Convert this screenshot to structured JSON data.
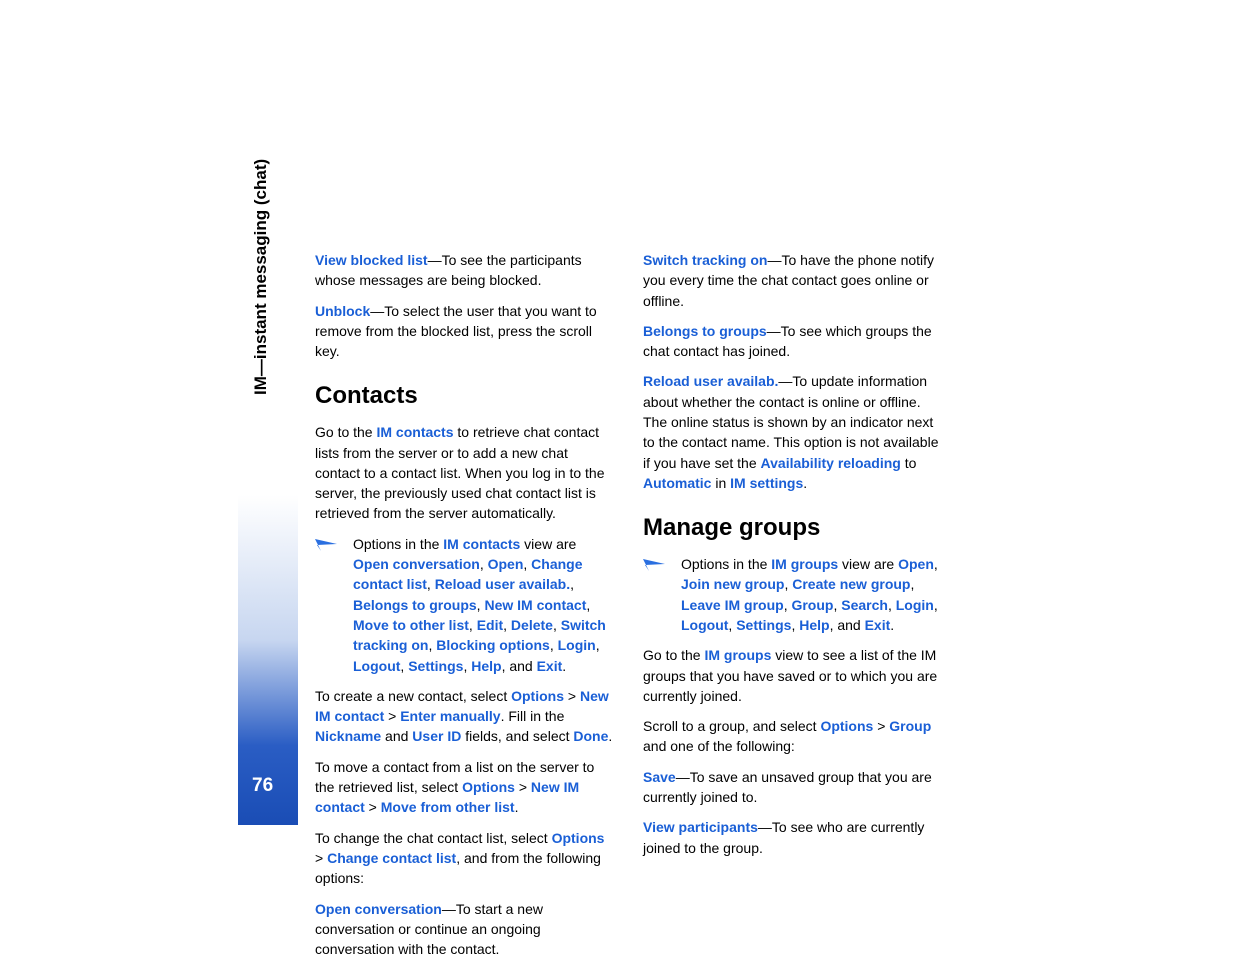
{
  "sidebar": {
    "label": "IM—instant messaging (chat)",
    "page": "76"
  },
  "left": {
    "p1_kw": "View blocked list",
    "p1_txt": "—To see the participants whose messages are being blocked.",
    "p2_kw": "Unblock",
    "p2_txt": "—To select the user that you want to remove from the blocked list, press the scroll key.",
    "h1": "Contacts",
    "p3a": "Go to the ",
    "p3_kw": "IM contacts",
    "p3b": " to retrieve chat contact lists from the server or to add a new chat contact to a contact list. When you log in to the server, the previously used chat contact list is retrieved from the server automatically.",
    "tip1": {
      "a": "Options in the ",
      "kw1": "IM contacts",
      "b": " view are ",
      "kw2": "Open conversation",
      "c": ", ",
      "kw3": "Open",
      "kw4": "Change contact list",
      "kw5": "Reload user availab.",
      "kw6": "Belongs to groups",
      "kw7": "New IM contact",
      "kw8": "Move to other list",
      "kw9": "Edit",
      "kw10": "Delete",
      "kw11": "Switch tracking on",
      "kw12": "Blocking options",
      "kw13": "Login",
      "kw14": "Logout",
      "kw15": "Settings",
      "kw16": "Help",
      "d": ", and ",
      "kw17": "Exit",
      "e": "."
    },
    "p4a": "To create a new contact, select ",
    "p4_kw1": "Options",
    "p4b": " > ",
    "p4_kw2": "New IM contact",
    "p4_kw3": "Enter manually",
    "p4c": ". Fill in the ",
    "p4_kw4": "Nickname",
    "p4d": " and ",
    "p4_kw5": "User ID",
    "p4e": " fields, and select ",
    "p4_kw6": "Done",
    "p4f": ".",
    "p5a": "To move a contact from a list on the server to the retrieved list, select ",
    "p5_kw1": "Options",
    "p5_kw2": "New IM contact",
    "p5_kw3": "Move from other list",
    "p5b": ".",
    "p6a": "To change the chat contact list, select ",
    "p6_kw1": "Options",
    "p6_kw2": "Change contact list",
    "p6b": ", and from the following options:",
    "p7_kw": "Open conversation",
    "p7_txt": "—To start a new conversation or continue an ongoing conversation with the contact."
  },
  "right": {
    "p1_kw": "Switch tracking on",
    "p1_txt": "—To have the phone notify you every time the chat contact goes online or offline.",
    "p2_kw": "Belongs to groups",
    "p2_txt": "—To see which groups the chat contact has joined.",
    "p3_kw": "Reload user availab.",
    "p3a": "—To update information about whether the contact is online or offline. The online status is shown by an indicator next to the contact name. This option is not available if you have set the ",
    "p3_kw2": "Availability reloading",
    "p3b": " to ",
    "p3_kw3": "Automatic",
    "p3c": " in ",
    "p3_kw4": "IM settings",
    "p3d": ".",
    "h1": "Manage groups",
    "tip1": {
      "a": "Options in the ",
      "kw1": "IM groups",
      "b": " view are ",
      "kw2": "Open",
      "kw3": "Join new group",
      "kw4": "Create new group",
      "kw5": "Leave IM group",
      "kw6": "Group",
      "kw7": "Search",
      "kw8": "Login",
      "kw9": "Logout",
      "kw10": "Settings",
      "kw11": "Help",
      "c": ", and ",
      "kw12": "Exit",
      "d": "."
    },
    "p4a": "Go to the ",
    "p4_kw": "IM groups",
    "p4b": " view to see a list of the IM groups that you have saved or to which you are currently joined.",
    "p5a": "Scroll to a group, and select ",
    "p5_kw1": "Options",
    "p5_kw2": "Group",
    "p5b": " and one of the following:",
    "p6_kw": "Save",
    "p6_txt": "—To save an unsaved group that you are currently joined to.",
    "p7_kw": "View participants",
    "p7_txt": "—To see who are currently joined to the group."
  }
}
